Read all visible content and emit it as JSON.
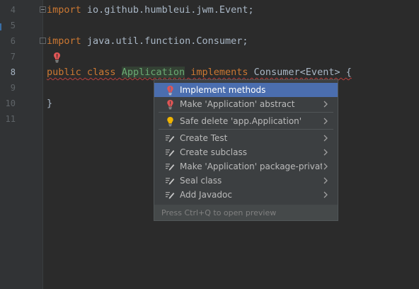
{
  "editor": {
    "line_numbers": [
      "4",
      "5",
      "6",
      "7",
      "8",
      "9",
      "10",
      "11"
    ],
    "current_line": "8",
    "lines": {
      "l4_kw": "import",
      "l4_rest": " io.github.humbleui.jwm.Event;",
      "l6_kw": "import",
      "l6_rest": " java.util.function.Consumer;",
      "l8_public": "public",
      "l8_class": "class",
      "l8_name": "Application",
      "l8_implements": "implements",
      "l8_rest": " Consumer<Event> {",
      "l10": "}"
    }
  },
  "intention_menu": {
    "items": [
      {
        "label": "Implement methods",
        "icon": "red-bulb-icon"
      },
      {
        "label": "Make 'Application' abstract",
        "icon": "red-bulb-icon"
      },
      {
        "label": "Safe delete 'app.Application'",
        "icon": "yellow-bulb-icon"
      },
      {
        "label": "Create Test",
        "icon": "intention-edit-icon"
      },
      {
        "label": "Create subclass",
        "icon": "intention-edit-icon"
      },
      {
        "label": "Make 'Application' package-private",
        "icon": "intention-edit-icon"
      },
      {
        "label": "Seal class",
        "icon": "intention-edit-icon"
      },
      {
        "label": "Add Javadoc",
        "icon": "intention-edit-icon"
      }
    ],
    "footer": "Press Ctrl+Q to open preview"
  },
  "colors": {
    "background": "#2b2b2b",
    "keyword": "#cc7832",
    "selection": "#4b6eaf",
    "error_bulb": "#e06c75",
    "warning_bulb": "#f0b400"
  }
}
